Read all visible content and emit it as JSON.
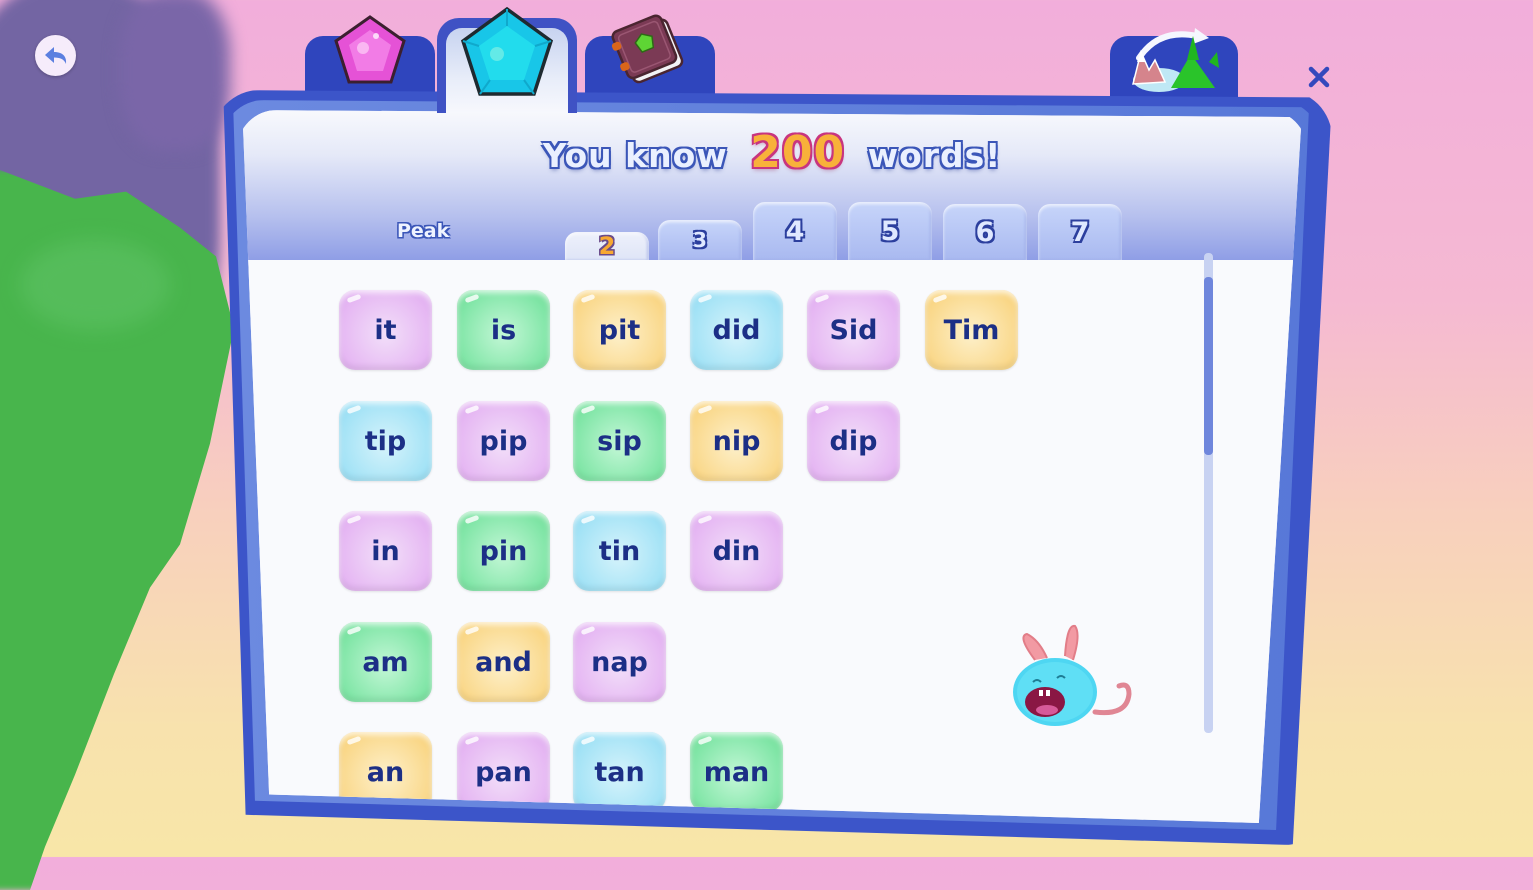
{
  "title": {
    "prefix": "You know",
    "count": "200",
    "suffix": "words!"
  },
  "top_tabs": [
    {
      "name": "pink-gem",
      "icon": "pink-gem-icon",
      "active": false
    },
    {
      "name": "blue-gem",
      "icon": "blue-gem-icon",
      "active": true
    },
    {
      "name": "book",
      "icon": "book-icon",
      "active": false
    }
  ],
  "map_button": {
    "icon": "world-map-swap-icon"
  },
  "back_button": {
    "icon": "back-arrow-icon"
  },
  "close_button": {
    "icon": "close-icon",
    "label": "×"
  },
  "levels": {
    "label": "Peak",
    "tabs": [
      "2",
      "3",
      "4",
      "5",
      "6",
      "7"
    ],
    "active": "2"
  },
  "words": [
    [
      {
        "text": "it",
        "color": "pink"
      },
      {
        "text": "is",
        "color": "green"
      },
      {
        "text": "pit",
        "color": "yellow"
      },
      {
        "text": "did",
        "color": "blue"
      },
      {
        "text": "Sid",
        "color": "pink"
      },
      {
        "text": "Tim",
        "color": "yellow"
      }
    ],
    [
      {
        "text": "tip",
        "color": "blue"
      },
      {
        "text": "pip",
        "color": "pink"
      },
      {
        "text": "sip",
        "color": "green"
      },
      {
        "text": "nip",
        "color": "yellow"
      },
      {
        "text": "dip",
        "color": "pink"
      }
    ],
    [
      {
        "text": "in",
        "color": "pink"
      },
      {
        "text": "pin",
        "color": "green"
      },
      {
        "text": "tin",
        "color": "blue"
      },
      {
        "text": "din",
        "color": "pink"
      }
    ],
    [
      {
        "text": "am",
        "color": "green"
      },
      {
        "text": "and",
        "color": "yellow"
      },
      {
        "text": "nap",
        "color": "pink"
      }
    ],
    [
      {
        "text": "an",
        "color": "yellow"
      },
      {
        "text": "pan",
        "color": "pink"
      },
      {
        "text": "tan",
        "color": "blue"
      },
      {
        "text": "man",
        "color": "green"
      }
    ]
  ],
  "scroll": {
    "position_fraction": 0.0,
    "visible_fraction": 0.37
  },
  "colors": {
    "frame": "#3c55c9",
    "word_text": "#1c2f86",
    "count": "#f8b13a"
  }
}
